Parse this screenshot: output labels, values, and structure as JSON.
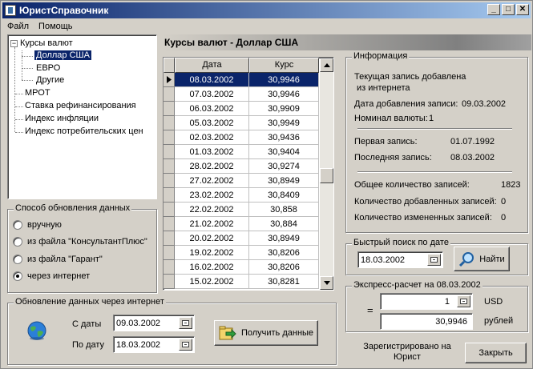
{
  "window": {
    "title": "ЮристСправочник",
    "buttons": {
      "minimize": "_",
      "maximize": "□",
      "close": "✕"
    }
  },
  "menu": [
    {
      "label": "Файл"
    },
    {
      "label": "Помощь"
    }
  ],
  "tree": {
    "items": [
      {
        "label": "Курсы валют",
        "toggle": "−"
      },
      {
        "label": "Доллар США"
      },
      {
        "label": "ЕВРО"
      },
      {
        "label": "Другие"
      },
      {
        "label": "МРОТ"
      },
      {
        "label": "Ставка рефинансирования"
      },
      {
        "label": "Индекс инфляции"
      },
      {
        "label": "Индекс потребительских цен"
      }
    ],
    "selected": "Доллар США"
  },
  "update_method": {
    "title": "Способ обновления данных",
    "options": [
      {
        "label": "вручную",
        "checked": false
      },
      {
        "label": "из файла \"КонсультантПлюс\"",
        "checked": false
      },
      {
        "label": "из файла \"Гарант\"",
        "checked": false
      },
      {
        "label": "через интернет",
        "checked": true
      }
    ]
  },
  "internet_update": {
    "title": "Обновление данных через интернет",
    "from_label": "С даты",
    "from_value": "09.03.2002",
    "to_label": "По дату",
    "to_value": "18.03.2002",
    "get_button": "Получить данные"
  },
  "header": {
    "title": "Курсы валют - Доллар США"
  },
  "grid": {
    "columns": [
      "Дата",
      "Курс"
    ],
    "rows": [
      [
        "08.03.2002",
        "30,9946"
      ],
      [
        "07.03.2002",
        "30,9946"
      ],
      [
        "06.03.2002",
        "30,9909"
      ],
      [
        "05.03.2002",
        "30,9949"
      ],
      [
        "02.03.2002",
        "30,9436"
      ],
      [
        "01.03.2002",
        "30,9404"
      ],
      [
        "28.02.2002",
        "30,9274"
      ],
      [
        "27.02.2002",
        "30,8949"
      ],
      [
        "23.02.2002",
        "30,8409"
      ],
      [
        "22.02.2002",
        "30,858"
      ],
      [
        "21.02.2002",
        "30,884"
      ],
      [
        "20.02.2002",
        "30,8949"
      ],
      [
        "19.02.2002",
        "30,8206"
      ],
      [
        "16.02.2002",
        "30,8206"
      ],
      [
        "15.02.2002",
        "30,8281"
      ]
    ],
    "selected_row": 0
  },
  "info": {
    "title": "Информация",
    "current_line1": "Текущая запись добавлена",
    "current_line2": "из интернета",
    "added_label": "Дата добавления записи:",
    "added_value": "09.03.2002",
    "nominal_label": "Номинал валюты:",
    "nominal_value": "1",
    "first_label": "Первая запись:",
    "first_value": "01.07.1992",
    "last_label": "Последняя запись:",
    "last_value": "08.03.2002",
    "total_label": "Общее количество записей:",
    "total_value": "1823",
    "added_count_label": "Количество добавленных записей:",
    "added_count_value": "0",
    "changed_count_label": "Количество измененных записей:",
    "changed_count_value": "0"
  },
  "quick_search": {
    "title": "Быстрый поиск по дате",
    "value": "18.03.2002",
    "button": "Найти"
  },
  "express": {
    "title": "Экспресс-расчет на 08.03.2002",
    "equals": "=",
    "amount": "1",
    "currency": "USD",
    "result": "30,9946",
    "result_currency": "рублей"
  },
  "footer": {
    "registered": "Зарегистрировано на Юрист",
    "close_button": "Закрыть"
  }
}
